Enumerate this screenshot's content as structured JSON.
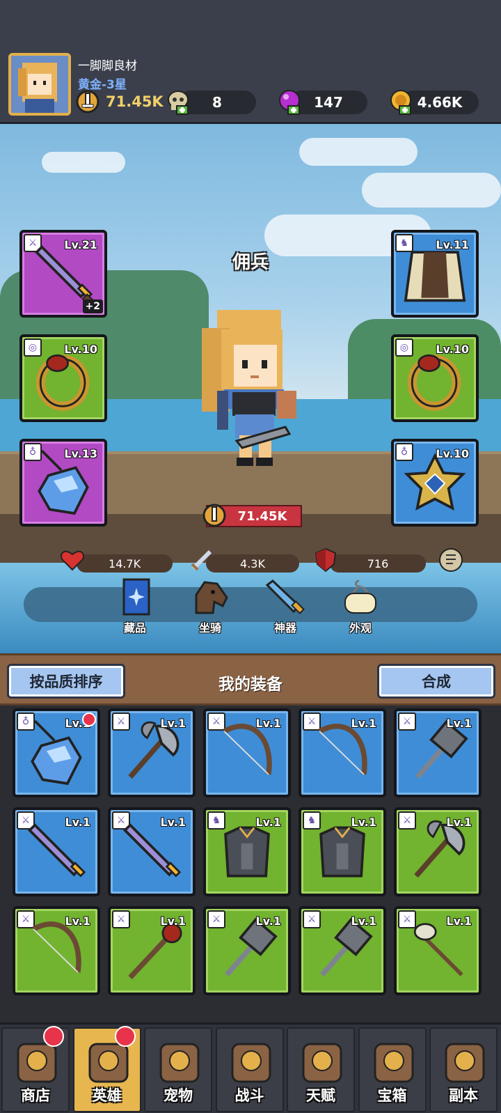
{
  "player": {
    "name": "一脚脚良材",
    "rank": "黄金-3星",
    "power": "71.45K"
  },
  "resources": {
    "skulls": "8",
    "gems": "147",
    "gold": "4.66K"
  },
  "hero": {
    "title": "佣兵",
    "power": "71.45K",
    "hp": "14.7K",
    "atk": "4.3K",
    "def": "716"
  },
  "equipped": {
    "left": [
      {
        "level": "Lv.21",
        "plus": "+2",
        "item": "sword",
        "rarity": "purple"
      },
      {
        "level": "Lv.10",
        "item": "ring",
        "rarity": "green"
      },
      {
        "level": "Lv.13",
        "item": "amulet",
        "rarity": "purple"
      }
    ],
    "right": [
      {
        "level": "Lv.11",
        "item": "cloak",
        "rarity": "blue"
      },
      {
        "level": "Lv.10",
        "item": "ring",
        "rarity": "green"
      },
      {
        "level": "Lv.10",
        "item": "star-necklace",
        "rarity": "blue"
      }
    ]
  },
  "collection_tabs": [
    "藏品",
    "坐骑",
    "神器",
    "外观"
  ],
  "equipment_bar": {
    "sort_label": "按品质排序",
    "title": "我的装备",
    "merge_label": "合成"
  },
  "inventory": [
    {
      "level": "Lv.1",
      "item": "amulet",
      "rarity": "blue",
      "badge": true
    },
    {
      "level": "Lv.1",
      "item": "axe",
      "rarity": "blue"
    },
    {
      "level": "Lv.1",
      "item": "bow",
      "rarity": "blue"
    },
    {
      "level": "Lv.1",
      "item": "bow",
      "rarity": "blue"
    },
    {
      "level": "Lv.1",
      "item": "hammer",
      "rarity": "blue"
    },
    {
      "level": "Lv.1",
      "item": "sword",
      "rarity": "blue"
    },
    {
      "level": "Lv.1",
      "item": "sword",
      "rarity": "blue"
    },
    {
      "level": "Lv.1",
      "item": "armor",
      "rarity": "green"
    },
    {
      "level": "Lv.1",
      "item": "armor",
      "rarity": "green"
    },
    {
      "level": "Lv.1",
      "item": "axe",
      "rarity": "green"
    },
    {
      "level": "Lv.1",
      "item": "bow",
      "rarity": "green"
    },
    {
      "level": "Lv.1",
      "item": "staff",
      "rarity": "green"
    },
    {
      "level": "Lv.1",
      "item": "hammer",
      "rarity": "green"
    },
    {
      "level": "Lv.1",
      "item": "hammer",
      "rarity": "green"
    },
    {
      "level": "Lv.1",
      "item": "skull-staff",
      "rarity": "green"
    }
  ],
  "nav": [
    {
      "label": "商店",
      "badge": true,
      "icon": "shop-icon"
    },
    {
      "label": "英雄",
      "badge": true,
      "icon": "hero-icon",
      "active": true
    },
    {
      "label": "宠物",
      "icon": "pet-icon"
    },
    {
      "label": "战斗",
      "icon": "battle-icon"
    },
    {
      "label": "天赋",
      "icon": "talent-icon"
    },
    {
      "label": "宝箱",
      "icon": "chest-icon"
    },
    {
      "label": "副本",
      "icon": "dungeon-icon"
    }
  ],
  "colors": {
    "purple": "#b24ac4",
    "blue": "#3f8dd6",
    "green": "#72b330",
    "badge": "#e8344a"
  }
}
